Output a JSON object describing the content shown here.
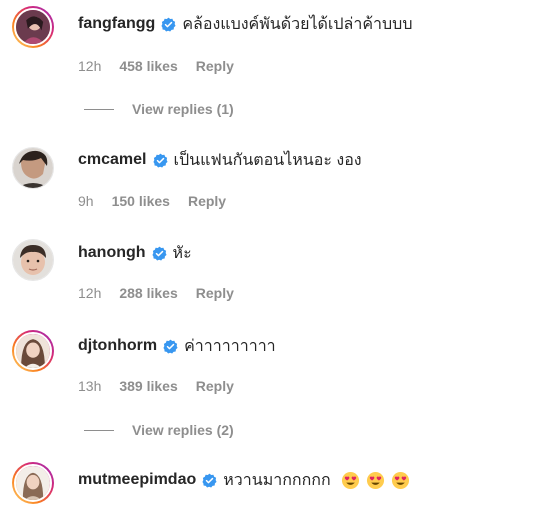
{
  "comments": [
    {
      "username": "fangfangg",
      "text": "คล้องแบงค์พันด้วยได้เปล่าค้าบบบ",
      "time": "12h",
      "likes": "458 likes",
      "reply": "Reply",
      "view_replies": "View replies (1)"
    },
    {
      "username": "cmcamel",
      "text": "เป็นแฟนกันตอนไหนอะ งอง",
      "time": "9h",
      "likes": "150 likes",
      "reply": "Reply"
    },
    {
      "username": "hanongh",
      "text": "หัะ",
      "time": "12h",
      "likes": "288 likes",
      "reply": "Reply"
    },
    {
      "username": "djtonhorm",
      "text": "ค่าาาาาาาาา",
      "time": "13h",
      "likes": "389 likes",
      "reply": "Reply",
      "view_replies": "View replies (2)"
    },
    {
      "username": "mutmeepimdao",
      "text": "หวานมากกกกก",
      "emojis": [
        "smiling-face-with-heart-eyes-icon",
        "smiling-face-with-heart-eyes-icon",
        "smiling-face-with-heart-eyes-icon"
      ]
    }
  ],
  "colors": {
    "verified": "#3897f0",
    "meta": "#8e8e8e",
    "text": "#262626"
  }
}
